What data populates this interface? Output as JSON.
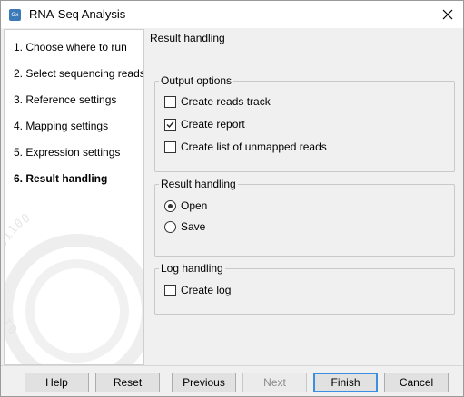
{
  "window": {
    "title": "RNA-Seq Analysis",
    "app_icon_text": "Gx"
  },
  "steps": [
    {
      "label": "1.   Choose where to run"
    },
    {
      "label": "2.   Select sequencing reads"
    },
    {
      "label": "3.   Reference settings"
    },
    {
      "label": "4.   Mapping settings"
    },
    {
      "label": "5.   Expression settings"
    },
    {
      "label": "6.   Result handling"
    }
  ],
  "active_step_index": 5,
  "content": {
    "title": "Result handling",
    "output_options": {
      "title": "Output options",
      "options": [
        {
          "label": "Create reads track",
          "checked": false
        },
        {
          "label": "Create report",
          "checked": true
        },
        {
          "label": "Create list of unmapped reads",
          "checked": false
        }
      ]
    },
    "result_handling": {
      "title": "Result handling",
      "options": [
        {
          "label": "Open",
          "selected": true
        },
        {
          "label": "Save",
          "selected": false
        }
      ]
    },
    "log_handling": {
      "title": "Log handling",
      "options": [
        {
          "label": "Create log",
          "checked": false
        }
      ]
    }
  },
  "buttons": {
    "help": "Help",
    "reset": "Reset",
    "previous": "Previous",
    "next": "Next",
    "finish": "Finish",
    "cancel": "Cancel"
  },
  "colors": {
    "default_button_border": "#3b8ee0",
    "panel_background": "#f0f0f0"
  },
  "watermark_text": "0101000110101100"
}
